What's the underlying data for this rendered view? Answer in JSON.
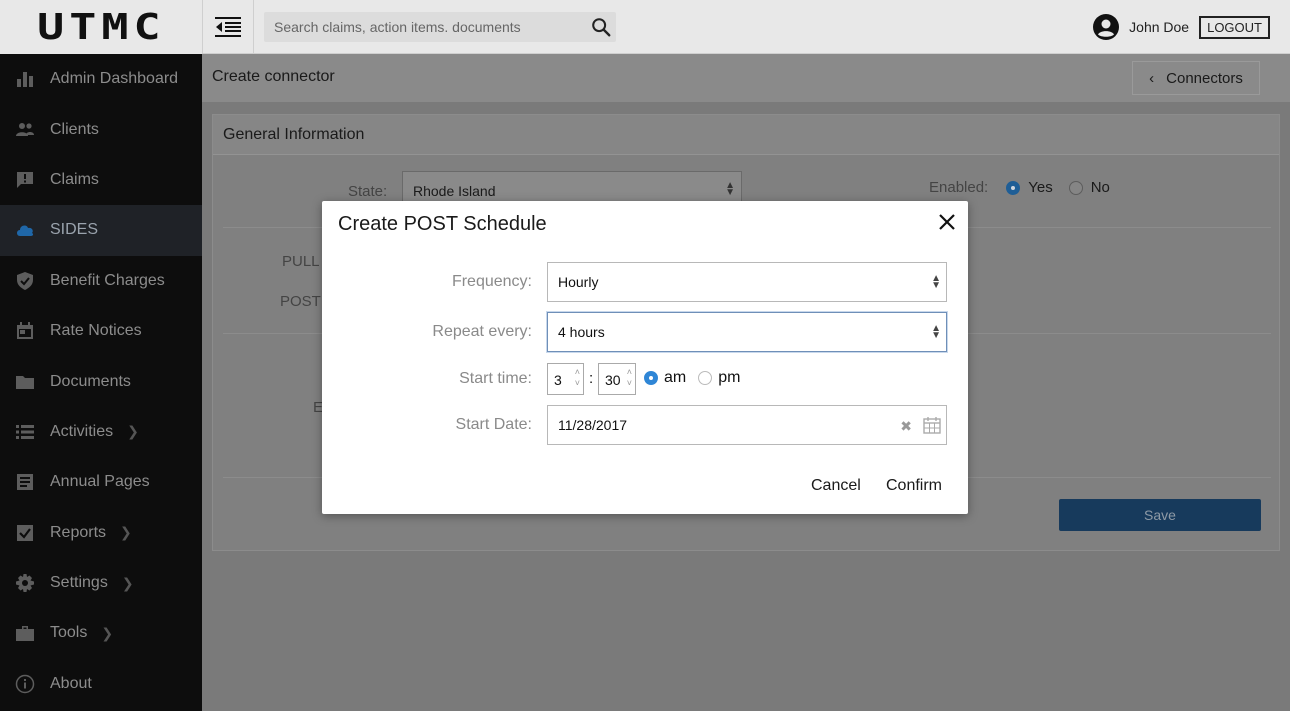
{
  "header": {
    "logo_text": "UTMC",
    "search_placeholder": "Search claims, action items. documents",
    "user_name": "John Doe",
    "logout_label": "LOGOUT"
  },
  "sidebar": {
    "items": [
      {
        "label": "Admin Dashboard",
        "icon": "bar-chart-icon"
      },
      {
        "label": "Clients",
        "icon": "people-icon"
      },
      {
        "label": "Claims",
        "icon": "comment-alert-icon"
      },
      {
        "label": "SIDES",
        "icon": "cloud-icon",
        "active": true
      },
      {
        "label": "Benefit Charges",
        "icon": "shield-check-icon"
      },
      {
        "label": "Rate Notices",
        "icon": "calendar-icon"
      },
      {
        "label": "Documents",
        "icon": "folder-icon"
      },
      {
        "label": "Activities",
        "icon": "list-icon",
        "submenu": true
      },
      {
        "label": "Annual Pages",
        "icon": "document-icon"
      },
      {
        "label": "Reports",
        "icon": "checkbox-icon",
        "submenu": true
      },
      {
        "label": "Settings",
        "icon": "gear-icon",
        "submenu": true
      },
      {
        "label": "Tools",
        "icon": "briefcase-icon",
        "submenu": true
      },
      {
        "label": "About",
        "icon": "info-icon"
      }
    ]
  },
  "page": {
    "title": "Create connector",
    "back_label": "Connectors",
    "section_title": "General Information",
    "state_label": "State:",
    "state_value": "Rhode Island",
    "enabled_label": "Enabled:",
    "enabled_yes": "Yes",
    "enabled_no": "No",
    "pull_label_partial": "PULL S",
    "post_label_partial": "POST S",
    "other_label_partial": "E",
    "save_label": "Save"
  },
  "modal": {
    "title": "Create POST Schedule",
    "frequency_label": "Frequency:",
    "frequency_value": "Hourly",
    "repeat_label": "Repeat every:",
    "repeat_value": "4 hours",
    "start_time_label": "Start time:",
    "hour_value": "3",
    "minute_value": "30",
    "colon": ":",
    "am_label": "am",
    "pm_label": "pm",
    "start_date_label": "Start Date:",
    "start_date_value": "11/28/2017",
    "clear_glyph": "✖",
    "cancel_label": "Cancel",
    "confirm_label": "Confirm"
  },
  "colors": {
    "accent": "#2f86d6",
    "save_button": "#173a5c",
    "sidebar_bg": "#0d0d0d"
  }
}
